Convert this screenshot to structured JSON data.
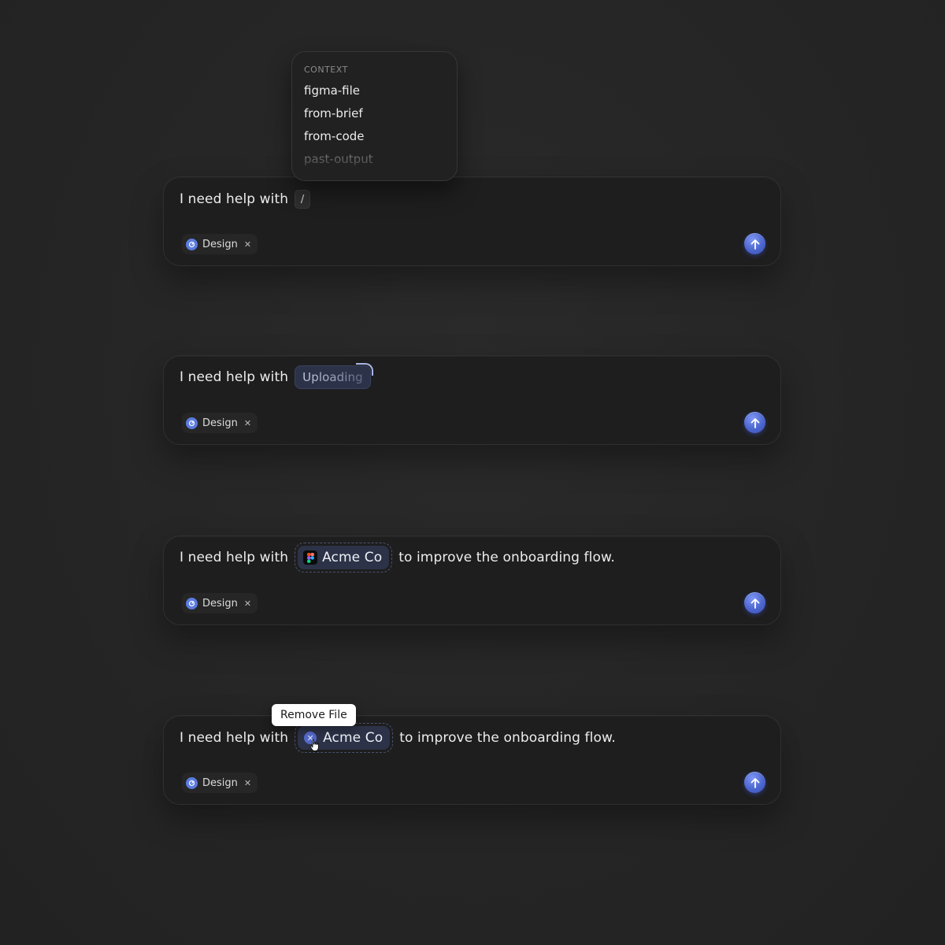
{
  "colors": {
    "background": "#272727",
    "panel": "#1e1e1e",
    "accent": "#4c66cf",
    "token_bg": "#2c3247"
  },
  "dropdown": {
    "heading": "CONTEXT",
    "items": [
      "figma-file",
      "from-brief",
      "from-code",
      "past-output"
    ]
  },
  "composers": [
    {
      "prompt": "I need help with",
      "token_slash": "/",
      "tag_label": "Design",
      "tag_icon": "design-icon",
      "send_icon": "arrow-up-icon"
    },
    {
      "prompt": "I need help with",
      "token_uploading": "Uploading",
      "tag_label": "Design",
      "send_icon": "arrow-up-icon"
    },
    {
      "prompt": "I need help with",
      "file_name": "Acme Co",
      "file_icon": "figma-icon",
      "after_text": "to improve the onboarding flow.",
      "tag_label": "Design",
      "send_icon": "arrow-up-icon"
    },
    {
      "prompt": "I need help with",
      "file_name": "Acme Co",
      "file_icon": "remove-file-icon",
      "after_text": "to improve the onboarding flow.",
      "tag_label": "Design",
      "send_icon": "arrow-up-icon"
    }
  ],
  "tooltip": {
    "text": "Remove File"
  }
}
